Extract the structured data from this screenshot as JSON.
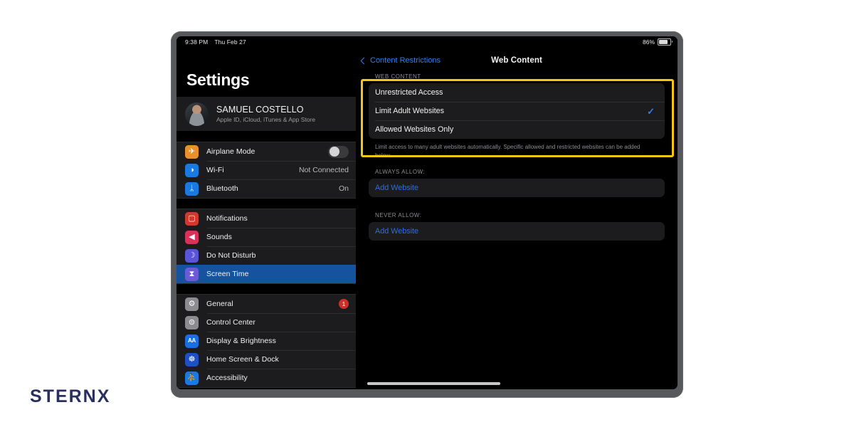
{
  "status_bar": {
    "time": "9:38 PM",
    "date": "Thu Feb 27",
    "battery_percent": "86%",
    "battery_level": 86
  },
  "sidebar": {
    "title": "Settings",
    "account": {
      "name": "SAMUEL COSTELLO",
      "subtitle": "Apple ID, iCloud, iTunes & App Store"
    },
    "groups": [
      {
        "items": [
          {
            "label": "Airplane Mode",
            "icon": "airplane-icon",
            "glyph": "✈",
            "icon_class": "ic-airplane",
            "control": "toggle",
            "toggle_on": false
          },
          {
            "label": "Wi-Fi",
            "icon": "wifi-icon",
            "glyph": "◑",
            "icon_class": "ic-wifi",
            "value": "Not Connected"
          },
          {
            "label": "Bluetooth",
            "icon": "bluetooth-icon",
            "glyph": "ᛦ",
            "icon_class": "ic-bluetooth",
            "value": "On"
          }
        ]
      },
      {
        "items": [
          {
            "label": "Notifications",
            "icon": "notifications-icon",
            "glyph": "▢",
            "icon_class": "ic-notif"
          },
          {
            "label": "Sounds",
            "icon": "sounds-icon",
            "glyph": "◀",
            "icon_class": "ic-sounds"
          },
          {
            "label": "Do Not Disturb",
            "icon": "moon-icon",
            "glyph": "☽",
            "icon_class": "ic-dnd"
          },
          {
            "label": "Screen Time",
            "icon": "hourglass-icon",
            "glyph": "⧗",
            "icon_class": "ic-screentime",
            "selected": true
          }
        ]
      },
      {
        "items": [
          {
            "label": "General",
            "icon": "gear-icon",
            "glyph": "⚙",
            "icon_class": "ic-general",
            "badge": "1"
          },
          {
            "label": "Control Center",
            "icon": "sliders-icon",
            "glyph": "⊜",
            "icon_class": "ic-control"
          },
          {
            "label": "Display & Brightness",
            "icon": "text-size-icon",
            "glyph": "AA",
            "icon_class": "ic-display"
          },
          {
            "label": "Home Screen & Dock",
            "icon": "app-grid-icon",
            "glyph": "☸",
            "icon_class": "ic-home"
          },
          {
            "label": "Accessibility",
            "icon": "accessibility-icon",
            "glyph": "⛹",
            "icon_class": "ic-access"
          }
        ]
      }
    ]
  },
  "main": {
    "back_label": "Content Restrictions",
    "title": "Web Content",
    "web_content_section": {
      "header": "WEB CONTENT",
      "options": [
        {
          "label": "Unrestricted Access",
          "checked": false
        },
        {
          "label": "Limit Adult Websites",
          "checked": true
        },
        {
          "label": "Allowed Websites Only",
          "checked": false
        }
      ],
      "footer": "Limit access to many adult websites automatically. Specific allowed and restricted websites can be added below."
    },
    "always_allow_section": {
      "header": "ALWAYS ALLOW:",
      "add_label": "Add Website"
    },
    "never_allow_section": {
      "header": "NEVER ALLOW:",
      "add_label": "Add Website"
    }
  },
  "highlight": {
    "color": "#f5c518"
  },
  "branding": {
    "logo_text": "STERNX",
    "logo_color": "#2b2f5e"
  },
  "accent_colors": {
    "link": "#2f7fe8",
    "selected_row": "#15539e",
    "badge": "#cf2f2a"
  }
}
